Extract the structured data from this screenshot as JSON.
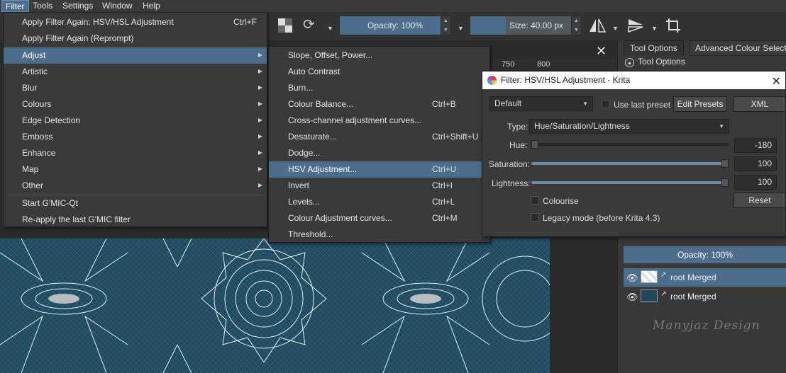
{
  "menubar": {
    "items": [
      "Filter",
      "Tools",
      "Settings",
      "Window",
      "Help"
    ]
  },
  "toolbar": {
    "opacity": "Opacity: 100%",
    "size": "Size: 40.00 px"
  },
  "filter_menu": {
    "items": [
      {
        "label": "Apply Filter Again: HSV/HSL Adjustment",
        "shortcut": "Ctrl+F"
      },
      {
        "label": "Apply Filter Again (Reprompt)",
        "shortcut": ""
      },
      {
        "label": "Adjust",
        "submenu": true
      },
      {
        "label": "Artistic",
        "submenu": true
      },
      {
        "label": "Blur",
        "submenu": true
      },
      {
        "label": "Colours",
        "submenu": true
      },
      {
        "label": "Edge Detection",
        "submenu": true
      },
      {
        "label": "Emboss",
        "submenu": true
      },
      {
        "label": "Enhance",
        "submenu": true
      },
      {
        "label": "Map",
        "submenu": true
      },
      {
        "label": "Other",
        "submenu": true
      },
      {
        "label": "Start G'MIC-Qt",
        "shortcut": ""
      },
      {
        "label": "Re-apply the last G'MIC filter",
        "shortcut": ""
      }
    ]
  },
  "adjust_menu": {
    "items": [
      {
        "label": "Slope, Offset, Power...",
        "shortcut": ""
      },
      {
        "label": "Auto Contrast",
        "shortcut": ""
      },
      {
        "label": "Burn...",
        "shortcut": ""
      },
      {
        "label": "Colour Balance...",
        "shortcut": "Ctrl+B"
      },
      {
        "label": "Cross-channel adjustment curves...",
        "shortcut": ""
      },
      {
        "label": "Desaturate...",
        "shortcut": "Ctrl+Shift+U"
      },
      {
        "label": "Dodge...",
        "shortcut": ""
      },
      {
        "label": "HSV Adjustment...",
        "shortcut": "Ctrl+U"
      },
      {
        "label": "Invert",
        "shortcut": "Ctrl+I"
      },
      {
        "label": "Levels...",
        "shortcut": "Ctrl+L"
      },
      {
        "label": "Colour Adjustment curves...",
        "shortcut": "Ctrl+M"
      },
      {
        "label": "Threshold...",
        "shortcut": ""
      }
    ]
  },
  "ruler": {
    "ticks": [
      "750",
      "800"
    ]
  },
  "docker": {
    "tabs": [
      "Tool Options",
      "Advanced Colour Selecto"
    ],
    "title": "Tool Options",
    "layers_opacity": "Opacity:  100%",
    "layers": [
      {
        "name": "root Merged"
      },
      {
        "name": "root Merged"
      }
    ],
    "watermark": "Manyjaz Design"
  },
  "dialog": {
    "title": "Filter: HSV/HSL Adjustment - Krita",
    "preset": "Default",
    "use_last_preset": "Use last preset",
    "edit_presets": "Edit Presets",
    "xml": "XML",
    "type_label": "Type:",
    "type_value": "Hue/Saturation/Lightness",
    "hue_label": "Hue:",
    "hue_value": "-180",
    "saturation_label": "Saturation:",
    "saturation_value": "100",
    "lightness_label": "Lightness:",
    "lightness_value": "100",
    "colourise": "Colourise",
    "legacy": "Legacy mode (before Krita 4.3)",
    "reset": "Reset"
  },
  "colors": {
    "accent": "#4d6d8c",
    "canvas": "#1f4a5f"
  }
}
